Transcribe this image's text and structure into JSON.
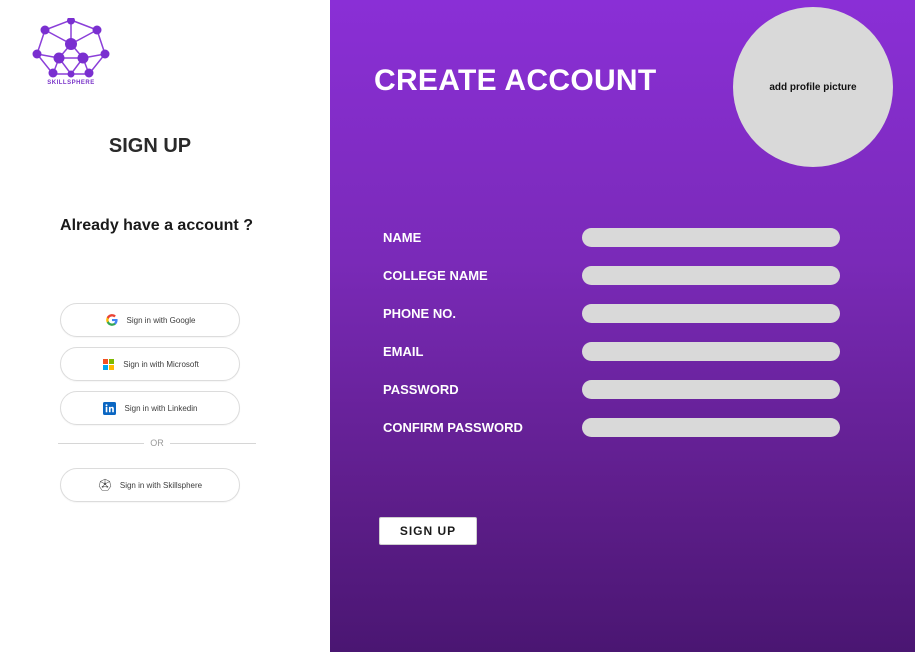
{
  "brand": {
    "logo_text": "SKILLSPHERE",
    "accent_color": "#8a2fd6"
  },
  "left": {
    "heading": "SIGN UP",
    "prompt": "Already have a account ?",
    "providers": [
      {
        "icon": "google-icon",
        "label": "Sign in with Google"
      },
      {
        "icon": "microsoft-icon",
        "label": "Sign in with Microsoft"
      },
      {
        "icon": "linkedin-icon",
        "label": "Sign in with Linkedin"
      },
      {
        "icon": "skillsphere-icon",
        "label": "Sign in with Skillsphere"
      }
    ],
    "divider_text": "OR"
  },
  "right": {
    "title": "CREATE ACCOUNT",
    "avatar_label": "add profile picture",
    "fields": [
      {
        "label": "NAME",
        "value": ""
      },
      {
        "label": "COLLEGE NAME",
        "value": ""
      },
      {
        "label": "PHONE NO.",
        "value": ""
      },
      {
        "label": "EMAIL",
        "value": ""
      },
      {
        "label": "PASSWORD",
        "value": ""
      },
      {
        "label": "CONFIRM PASSWORD",
        "value": ""
      }
    ],
    "submit_label": "SIGN UP"
  }
}
